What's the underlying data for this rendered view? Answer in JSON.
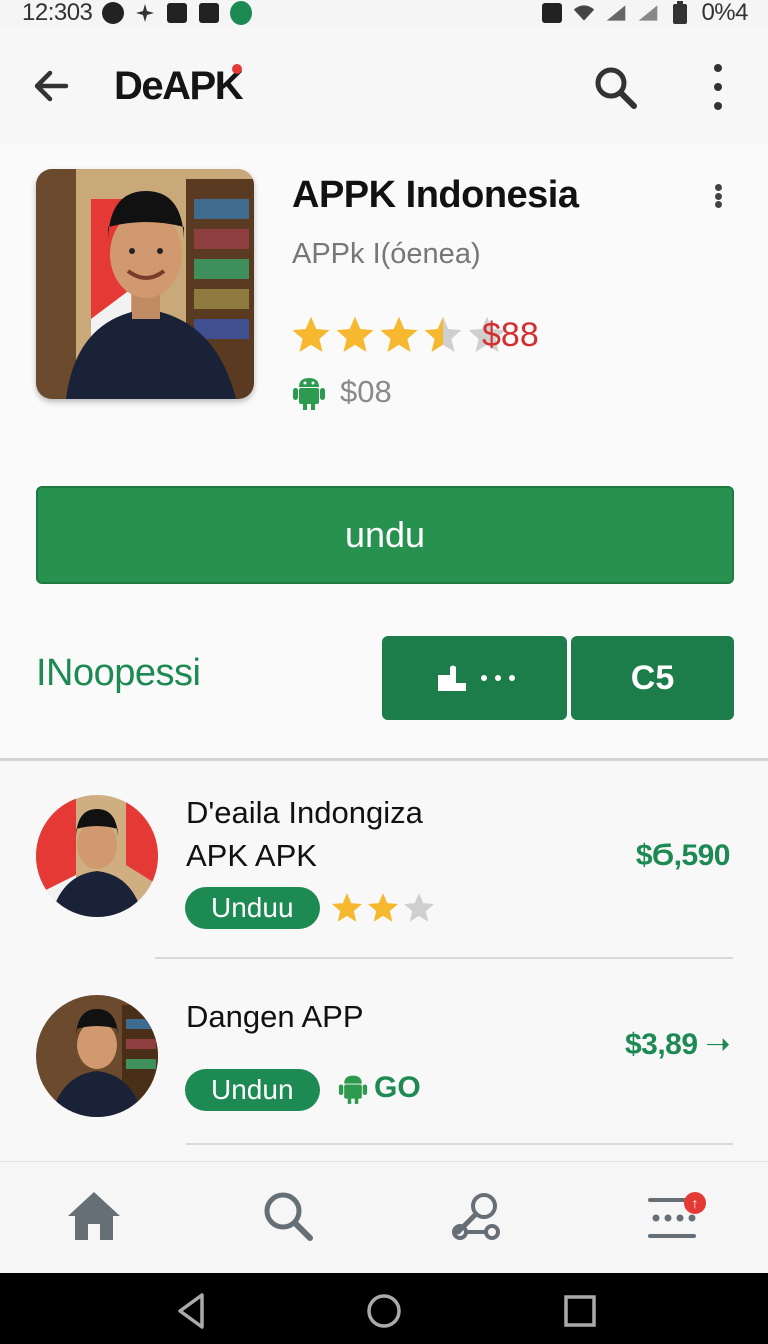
{
  "status_bar": {
    "time": "12:303",
    "battery": "0%4",
    "icons": [
      "globe-icon",
      "fan-icon",
      "nfc-icon",
      "edit-icon",
      "whatsapp-icon",
      "silent-icon",
      "wifi-icon",
      "signal-icon",
      "battery-icon"
    ]
  },
  "app_bar": {
    "title": "DeAPK",
    "icons": [
      "back-arrow-icon",
      "search-icon",
      "more-vert-icon"
    ]
  },
  "app": {
    "name": "APPK Indonesia",
    "subtitle": "APPk I(óenea)",
    "rating": 3.5,
    "rating_max": 5,
    "price": "$88",
    "android_price": "$08",
    "download_label": "undu"
  },
  "section": {
    "title": "INoopessi",
    "chip_2_label": "C5"
  },
  "list": [
    {
      "title_line1": "D'eaila Indongiza",
      "title_line2": "APK APK",
      "price": "$Ϭ,590",
      "badge": "Unduu",
      "rating": 2,
      "rating_max": 3
    },
    {
      "title_line1": "Dangen APP",
      "price": "$3,89 ➝",
      "badge": "Undun",
      "tag": "GO"
    }
  ],
  "bottom_nav": {
    "items": [
      "home-icon",
      "search-icon",
      "tools-icon",
      "menu-icon"
    ],
    "badge": "↑"
  },
  "colors": {
    "accent": "#1e8a53",
    "price_red": "#d32f2f",
    "star": "#f5b82e"
  }
}
